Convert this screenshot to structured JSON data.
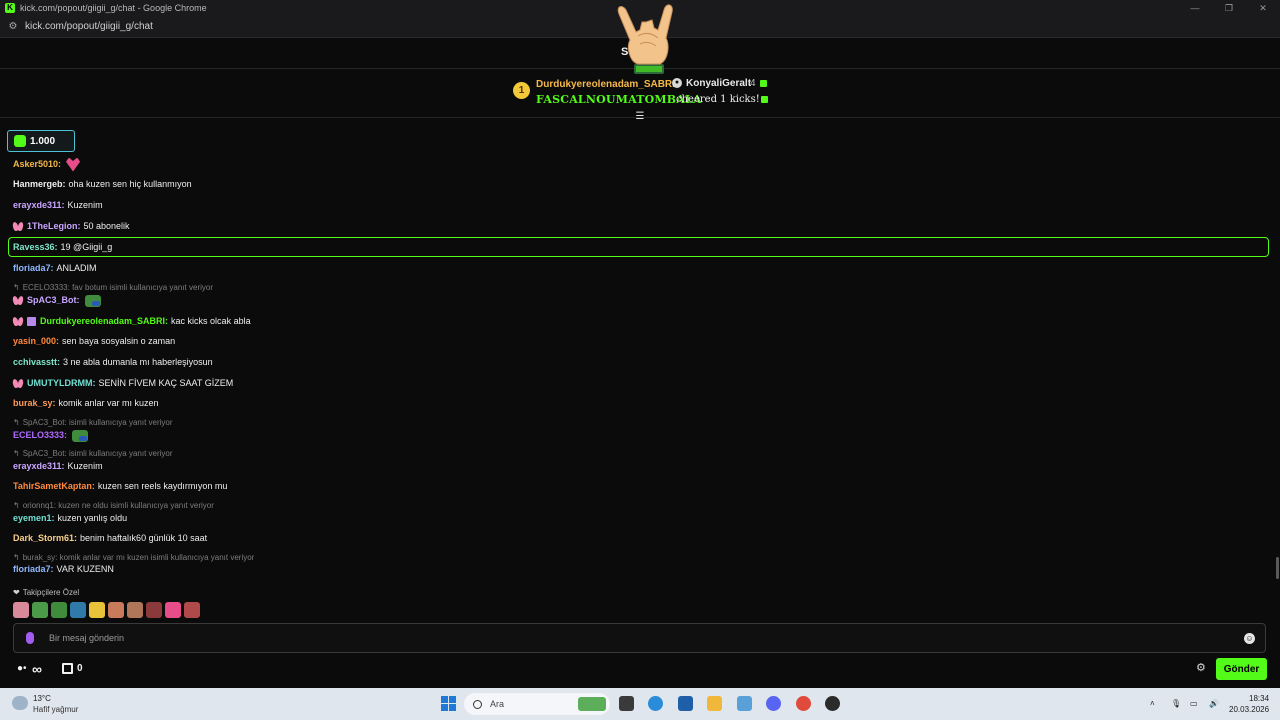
{
  "window": {
    "title": "kick.com/popout/giigii_g/chat - Google Chrome",
    "url": "kick.com/popout/giigii_g/chat",
    "controls": [
      "—",
      "❐",
      "✕"
    ]
  },
  "header": {
    "partial_title": "S"
  },
  "pinned": {
    "rank": "1",
    "user1": "Durdukyereolenadam_SABRI",
    "user2": "KonyaliGeralt",
    "user2_count": "4",
    "gift_text": "FASCALNOUMATOMBALA",
    "cheered_text": "cheered 1 kicks!"
  },
  "kick_counter": {
    "value": "1.000"
  },
  "messages": [
    {
      "user": "Asker5010",
      "color": "#f5b94a",
      "text": "",
      "emote": "pink"
    },
    {
      "user": "Hanmergeb",
      "color": "#efefef",
      "text": "oha kuzen sen hiç kullanmıyon"
    },
    {
      "user": "erayxde311",
      "color": "#c9a6ff",
      "text": "Kuzenim"
    },
    {
      "user": "1TheLegion",
      "color": "#c9a6ff",
      "text": "50 abonelik",
      "badge": "butterfly"
    },
    {
      "user": "Ravess36",
      "color": "#7fe6c9",
      "text": "19 @Giigii_g"
    },
    {
      "user": "floriada7",
      "color": "#8fb8ff",
      "text": "ANLADIM"
    },
    {
      "user": "SpAC3_Bot",
      "color": "#c9a6ff",
      "text": "",
      "badge": "butterfly",
      "emote": "frog",
      "reply": "ECELO3333: fav botum isimli kullanıcıya yanıt veriyor"
    },
    {
      "user": "Durdukyereolenadam_SABRI",
      "color": "#53fc18",
      "text": "kac kicks olcak abla",
      "badge": "butterfly",
      "gift": true
    },
    {
      "user": "yasin_000",
      "color": "#ff8a3d",
      "text": "sen baya sosyalsin o zaman"
    },
    {
      "user": "cchivasstt",
      "color": "#7fe6c9",
      "text": "3 ne abla dumanla mı haberleşiyosun"
    },
    {
      "user": "UMUTYLDRMM",
      "color": "#6fe0d2",
      "text": "SENİN FİVEM KAÇ SAAT GİZEM",
      "badge": "butterfly"
    },
    {
      "user": "burak_sy",
      "color": "#ff9a5a",
      "text": "komik anlar var mı kuzen"
    },
    {
      "user": "ECELO3333",
      "color": "#b06bff",
      "text": "",
      "emote": "frog",
      "reply": "SpAC3_Bot: isimli kullanıcıya yanıt veriyor"
    },
    {
      "user": "erayxde311",
      "color": "#c9a6ff",
      "text": "Kuzenim",
      "reply": "SpAC3_Bot: isimli kullanıcıya yanıt veriyor"
    },
    {
      "user": "TahirSametKaptan",
      "color": "#ff8a3d",
      "text": "kuzen sen reels kaydırmıyon mu"
    },
    {
      "user": "eyemen1",
      "color": "#6fe0d2",
      "text": "kuzen yanlış oldu",
      "reply": "orionnq1: kuzen ne oldu isimli kullanıcıya yanıt veriyor"
    },
    {
      "user": "Dark_Storm61",
      "color": "#f7d08a",
      "text": "benim haftalık60 günlük 10 saat"
    },
    {
      "user": "floriada7",
      "color": "#8fb8ff",
      "text": "VAR KUZENN",
      "reply": "burak_sy: komik anlar var mı kuzen isimli kullanıcıya yanıt veriyor"
    }
  ],
  "followers_only": {
    "label": "Takipçilere Özel"
  },
  "input": {
    "placeholder": "Bir mesaj gönderin"
  },
  "bottom": {
    "points_symbol": "∞",
    "store_count": "0",
    "send_label": "Gönder"
  },
  "taskbar": {
    "weather_temp": "13°C",
    "weather_desc": "Hafif yağmur",
    "search_text": "Ara",
    "time": "18:34",
    "date": "20.03.2026"
  }
}
